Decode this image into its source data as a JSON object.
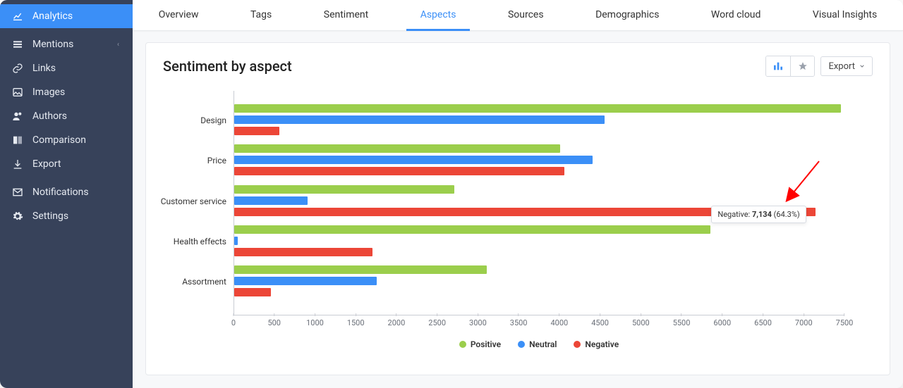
{
  "sidebar": {
    "items": [
      {
        "label": "Analytics",
        "icon": "chart-line-icon",
        "active": true
      },
      {
        "label": "Mentions",
        "icon": "list-icon",
        "chev": "‹"
      },
      {
        "label": "Links",
        "icon": "link-icon"
      },
      {
        "label": "Images",
        "icon": "image-icon"
      },
      {
        "label": "Authors",
        "icon": "people-icon"
      },
      {
        "label": "Comparison",
        "icon": "compare-icon"
      },
      {
        "label": "Export",
        "icon": "download-icon"
      },
      {
        "label": "Notifications",
        "icon": "mail-icon"
      },
      {
        "label": "Settings",
        "icon": "gear-icon"
      }
    ]
  },
  "tabs": [
    {
      "label": "Overview"
    },
    {
      "label": "Tags"
    },
    {
      "label": "Sentiment"
    },
    {
      "label": "Aspects",
      "active": true
    },
    {
      "label": "Sources"
    },
    {
      "label": "Demographics"
    },
    {
      "label": "Word cloud"
    },
    {
      "label": "Visual Insights"
    }
  ],
  "panel": {
    "title": "Sentiment by aspect",
    "export_label": "Export"
  },
  "colors": {
    "positive": "#9bce4c",
    "neutral": "#3b8ff7",
    "negative": "#ec4637"
  },
  "legend": {
    "positive": "Positive",
    "neutral": "Neutral",
    "negative": "Negative"
  },
  "tooltip": {
    "label": "Negative",
    "value": "7,134",
    "pct": "64.3%"
  },
  "chart_data": {
    "type": "bar",
    "orientation": "horizontal",
    "title": "Sentiment by aspect",
    "xlabel": "",
    "ylabel": "",
    "xlim": [
      0,
      7500
    ],
    "ticks": [
      0,
      500,
      1000,
      1500,
      2000,
      2500,
      3000,
      3500,
      4000,
      4500,
      5000,
      5500,
      6000,
      6500,
      7000,
      7500
    ],
    "categories": [
      "Design",
      "Price",
      "Customer service",
      "Health effects",
      "Assortment"
    ],
    "series": [
      {
        "name": "Positive",
        "values": [
          7450,
          4000,
          2700,
          5850,
          3100
        ]
      },
      {
        "name": "Neutral",
        "values": [
          4550,
          4400,
          900,
          40,
          1750
        ]
      },
      {
        "name": "Negative",
        "values": [
          550,
          4050,
          7134,
          1700,
          450
        ]
      }
    ],
    "legend_position": "bottom",
    "grid": false,
    "highlight": {
      "category": "Customer service",
      "series": "Negative",
      "value": 7134,
      "pct": 64.3
    }
  }
}
